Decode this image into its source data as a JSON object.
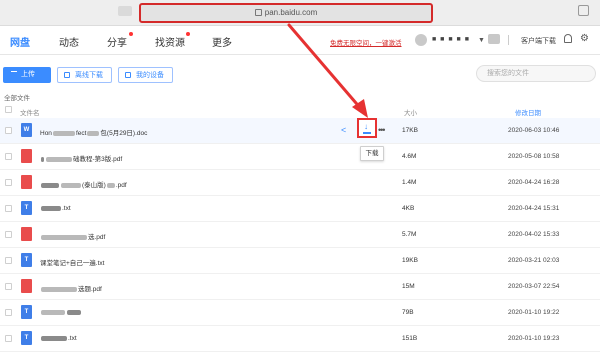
{
  "browser": {
    "url": "pan.baidu.com"
  },
  "nav": {
    "tabs": [
      {
        "label": "网盘"
      },
      {
        "label": "动态"
      },
      {
        "label": "分享"
      },
      {
        "label": "找资源"
      },
      {
        "label": "更多"
      }
    ],
    "promo": "免费无限空间，一键激活",
    "client_download": "客户端下载"
  },
  "toolbar": {
    "upload": "上传",
    "offline": "离线下载",
    "device": "我的设备",
    "search_placeholder": "搜索您的文件"
  },
  "breadcrumb": "全部文件",
  "table": {
    "headers": {
      "name": "文件名",
      "size": "大小",
      "date": "修改日期"
    },
    "rows": [
      {
        "type": "W",
        "color": "#3f7ee8",
        "name_prefix": "Hon",
        "name_mid": "fect",
        "name_suffix": "包(5月29日).doc",
        "size": "17KB",
        "date": "2020-06-03 10:46"
      },
      {
        "type": "PDF",
        "color": "#e94c4c",
        "name_suffix": "础教程-第3版.pdf",
        "size": "4.6M",
        "date": "2020-05-08 10:58"
      },
      {
        "type": "PDF",
        "color": "#e94c4c",
        "name_suffix": "(泰山版)",
        "name_ext": ".pdf",
        "size": "1.4M",
        "date": "2020-04-24 16:28"
      },
      {
        "type": "T",
        "color": "#3f7ee8",
        "name_suffix": ".txt",
        "size": "4KB",
        "date": "2020-04-24 15:31"
      },
      {
        "type": "PDF",
        "color": "#e94c4c",
        "name_suffix": "选.pdf",
        "size": "5.7M",
        "date": "2020-04-02 15:33"
      },
      {
        "type": "T",
        "color": "#3f7ee8",
        "name_full": "课堂笔记+自己一遍.txt",
        "size": "19KB",
        "date": "2020-03-21 02:03"
      },
      {
        "type": "PDF",
        "color": "#e94c4c",
        "name_suffix": "选题.pdf",
        "size": "15M",
        "date": "2020-03-07 22:54"
      },
      {
        "type": "T",
        "color": "#3f7ee8",
        "name_suffix": "",
        "size": "79B",
        "date": "2020-01-10 19:22"
      },
      {
        "type": "T",
        "color": "#3f7ee8",
        "name_suffix": ".txt",
        "size": "151B",
        "date": "2020-01-10 19:23"
      }
    ]
  },
  "tooltip": "下载",
  "accent": "#3b8cff",
  "highlight_color": "#e63232"
}
